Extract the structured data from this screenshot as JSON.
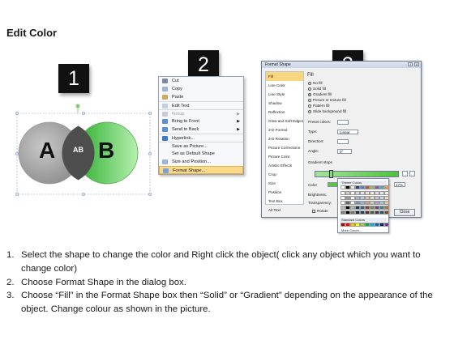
{
  "title": "Edit Color",
  "steps": {
    "one": "1",
    "two": "2",
    "three": "3"
  },
  "venn": {
    "label_a": "A",
    "label_b": "B",
    "label_ab": "AB",
    "color_a": "#8f8f8f",
    "color_b": "#3cc43c"
  },
  "context_menu": {
    "items": [
      {
        "label": "Cut",
        "icon": "scissors-icon"
      },
      {
        "label": "Copy",
        "icon": "copy-icon"
      },
      {
        "label": "Paste",
        "icon": "paste-icon"
      },
      {
        "label": "Edit Text",
        "icon": ""
      },
      {
        "label": "Group",
        "icon": "group-icon",
        "disabled": true,
        "submenu": true
      },
      {
        "label": "Bring to Front",
        "icon": "bring-front-icon",
        "submenu": true
      },
      {
        "label": "Send to Back",
        "icon": "send-back-icon",
        "submenu": true
      },
      {
        "label": "Hyperlink...",
        "icon": "hyperlink-icon"
      },
      {
        "label": "Save as Picture...",
        "icon": ""
      },
      {
        "label": "Set as Default Shape",
        "icon": ""
      },
      {
        "label": "Size and Position...",
        "icon": "size-icon"
      },
      {
        "label": "Format Shape...",
        "icon": "format-shape-icon",
        "highlighted": true
      }
    ]
  },
  "dialog": {
    "title": "Format Shape",
    "help": "?",
    "close_x": "X",
    "nav": [
      "Fill",
      "Line Color",
      "Line Style",
      "Shadow",
      "Reflection",
      "Glow and Soft Edges",
      "3-D Format",
      "3-D Rotation",
      "Picture Corrections",
      "Picture Color",
      "Artistic Effects",
      "Crop",
      "Size",
      "Position",
      "Text Box",
      "Alt Text"
    ],
    "section": "Fill",
    "fill_options": [
      {
        "label": "No fill",
        "selected": false
      },
      {
        "label": "Solid fill",
        "selected": false
      },
      {
        "label": "Gradient fill",
        "selected": true
      },
      {
        "label": "Picture or texture fill",
        "selected": false
      },
      {
        "label": "Pattern fill",
        "selected": false
      },
      {
        "label": "Slide background fill",
        "selected": false
      }
    ],
    "preset_colors_label": "Preset colors:",
    "type_label": "Type:",
    "type_value": "Linear",
    "direction_label": "Direction:",
    "angle_label": "Angle:",
    "angle_value": "0°",
    "gradient_stops_label": "Gradient stops",
    "color_label": "Color",
    "position_label": "Position:",
    "position_value": "17%",
    "brightness_label": "Brightness:",
    "transparency_label": "Transparency:",
    "rotate_label": "Rotate",
    "close_button": "Close"
  },
  "palette": {
    "theme_colors_label": "Theme Colors",
    "standard_colors_label": "Standard Colors",
    "more_colors_label": "More Colors...",
    "theme_top": [
      "#ffffff",
      "#000000",
      "#eeece1",
      "#1f497d",
      "#4f81bd",
      "#c0504d",
      "#9bbb59",
      "#8064a2",
      "#4bacc6",
      "#f79646"
    ],
    "standard": [
      "#c00000",
      "#ff0000",
      "#ffc000",
      "#ffff00",
      "#92d050",
      "#00b050",
      "#00b0f0",
      "#0070c0",
      "#002060",
      "#7030a0"
    ]
  },
  "instructions": [
    {
      "num": "1.",
      "text": "Select the shape to change the color and Right click the object( click any object which you want to change color)"
    },
    {
      "num": "2.",
      "text": "Choose Format Shape in the dialog box."
    },
    {
      "num": "3.",
      "text": "Choose “Fill” in the Format Shape box then “Solid” or “Gradient” depending on the appearance of the object. Change colour as shown in the picture."
    }
  ]
}
